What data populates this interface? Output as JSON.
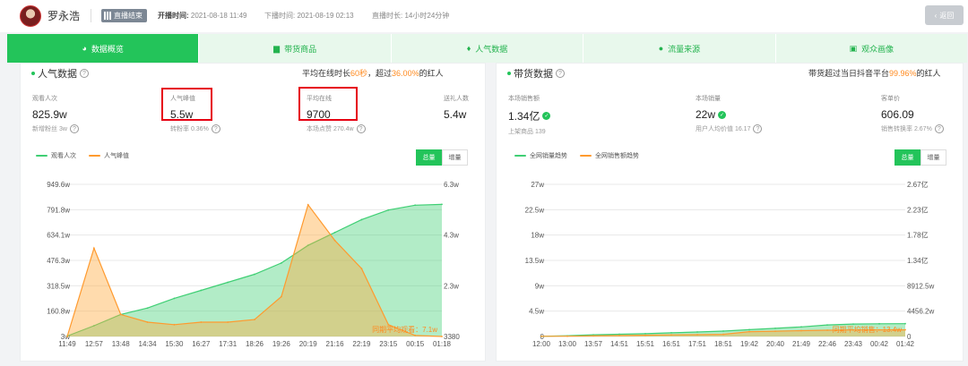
{
  "header": {
    "streamer_name": "罗永浩",
    "status_badge": "直播结束",
    "start_label": "开播时间:",
    "start_time": "2021-08-18 11:49",
    "end_label": "下播时间:",
    "end_time": "2021-08-19 02:13",
    "duration_label": "直播时长:",
    "duration": "14小时24分钟",
    "back_label": "返回"
  },
  "tabs": [
    {
      "label": "数据概览",
      "icon": "pie-chart-icon",
      "active": true
    },
    {
      "label": "带货商品",
      "icon": "bag-icon",
      "active": false
    },
    {
      "label": "人气数据",
      "icon": "flame-icon",
      "active": false
    },
    {
      "label": "流量来源",
      "icon": "drop-icon",
      "active": false
    },
    {
      "label": "观众画像",
      "icon": "portrait-icon",
      "active": false
    }
  ],
  "popularity": {
    "title": "人气数据",
    "note_prefix": "平均在线时长",
    "note_time": "60秒",
    "note_mid": "，超过",
    "note_pct": "36.00%",
    "note_suffix": "的红人",
    "stats": [
      {
        "label": "观看人次",
        "value": "825.9w",
        "sub": "新增粉丝 3w"
      },
      {
        "label": "人气峰值",
        "value": "5.5w",
        "sub": "转粉率 0.36%"
      },
      {
        "label": "平均在线",
        "value": "9700",
        "sub": "本场点赞 270.4w"
      },
      {
        "label": "送礼人数",
        "value": "5.4w",
        "sub": ""
      }
    ],
    "legend": [
      "观看人次",
      "人气峰值"
    ],
    "toggle": [
      "总量",
      "增量"
    ]
  },
  "sales": {
    "title": "带货数据",
    "note_prefix": "带货超过当日抖音平台",
    "note_pct": "99.96%",
    "note_suffix": "的红人",
    "stats": [
      {
        "label": "本场销售额",
        "value": "1.34亿",
        "sub": "上架商品 139"
      },
      {
        "label": "本场销量",
        "value": "22w",
        "sub": "用户人均价值 16.17"
      },
      {
        "label": "客单价",
        "value": "606.09",
        "sub": "销售转换率 2.67%"
      }
    ],
    "legend": [
      "全网销量趋势",
      "全网销售额趋势"
    ],
    "toggle": [
      "总量",
      "增量"
    ]
  },
  "colors": {
    "accent": "#23c45a",
    "accent_light": "#e8f8ec",
    "orange": "#ff9a2e",
    "highlight_box": "#e60012"
  },
  "chart_data": [
    {
      "type": "area",
      "x": [
        "11:49",
        "12:57",
        "13:48",
        "14:34",
        "15:30",
        "16:27",
        "17:31",
        "18:26",
        "19:26",
        "20:19",
        "21:16",
        "22:19",
        "23:15",
        "00:15",
        "01:18"
      ],
      "series": [
        {
          "name": "观看人次",
          "axis": "left",
          "values": [
            60000,
            700000,
            1400000,
            1800000,
            2400000,
            2900000,
            3400000,
            3900000,
            4600000,
            5700000,
            6500000,
            7300000,
            7900000,
            8200000,
            8250000
          ]
        },
        {
          "name": "人气峰值",
          "axis": "right",
          "values": [
            3380,
            38000,
            12000,
            9000,
            8000,
            9000,
            9000,
            10000,
            19000,
            55000,
            41000,
            30000,
            8000,
            3800,
            3380
          ]
        }
      ],
      "y_left_ticks": [
        "3w",
        "160.8w",
        "318.5w",
        "476.3w",
        "634.1w",
        "791.8w",
        "949.6w"
      ],
      "y_right_ticks": [
        "3380",
        "2.3w",
        "4.3w",
        "6.3w"
      ],
      "ref_label": "同期平均观看：7.1w",
      "grid": true
    },
    {
      "type": "area",
      "x": [
        "12:00",
        "13:00",
        "13:57",
        "14:51",
        "15:51",
        "16:51",
        "17:51",
        "18:51",
        "19:42",
        "20:40",
        "21:49",
        "22:46",
        "23:43",
        "00:42",
        "01:42"
      ],
      "series": [
        {
          "name": "全网销量趋势",
          "axis": "left",
          "values": [
            300,
            1200,
            3000,
            4000,
            5000,
            6500,
            8000,
            9500,
            12000,
            14500,
            17000,
            20500,
            22000,
            22500,
            22700
          ]
        },
        {
          "name": "全网销售额趋势",
          "axis": "right",
          "values": [
            300000,
            500000,
            1000000,
            1600000,
            2200000,
            2800000,
            3200000,
            3800000,
            8500000,
            9200000,
            10200000,
            11000000,
            11500000,
            11600000,
            11700000
          ]
        }
      ],
      "y_left_ticks": [
        "0",
        "4.5w",
        "9w",
        "13.5w",
        "18w",
        "22.5w",
        "27w"
      ],
      "y_right_ticks": [
        "0",
        "4456.2w",
        "8912.5w",
        "1.34亿",
        "1.78亿",
        "2.23亿",
        "2.67亿"
      ],
      "ref_label": "同期平均销售：13.4w",
      "grid": true
    }
  ]
}
